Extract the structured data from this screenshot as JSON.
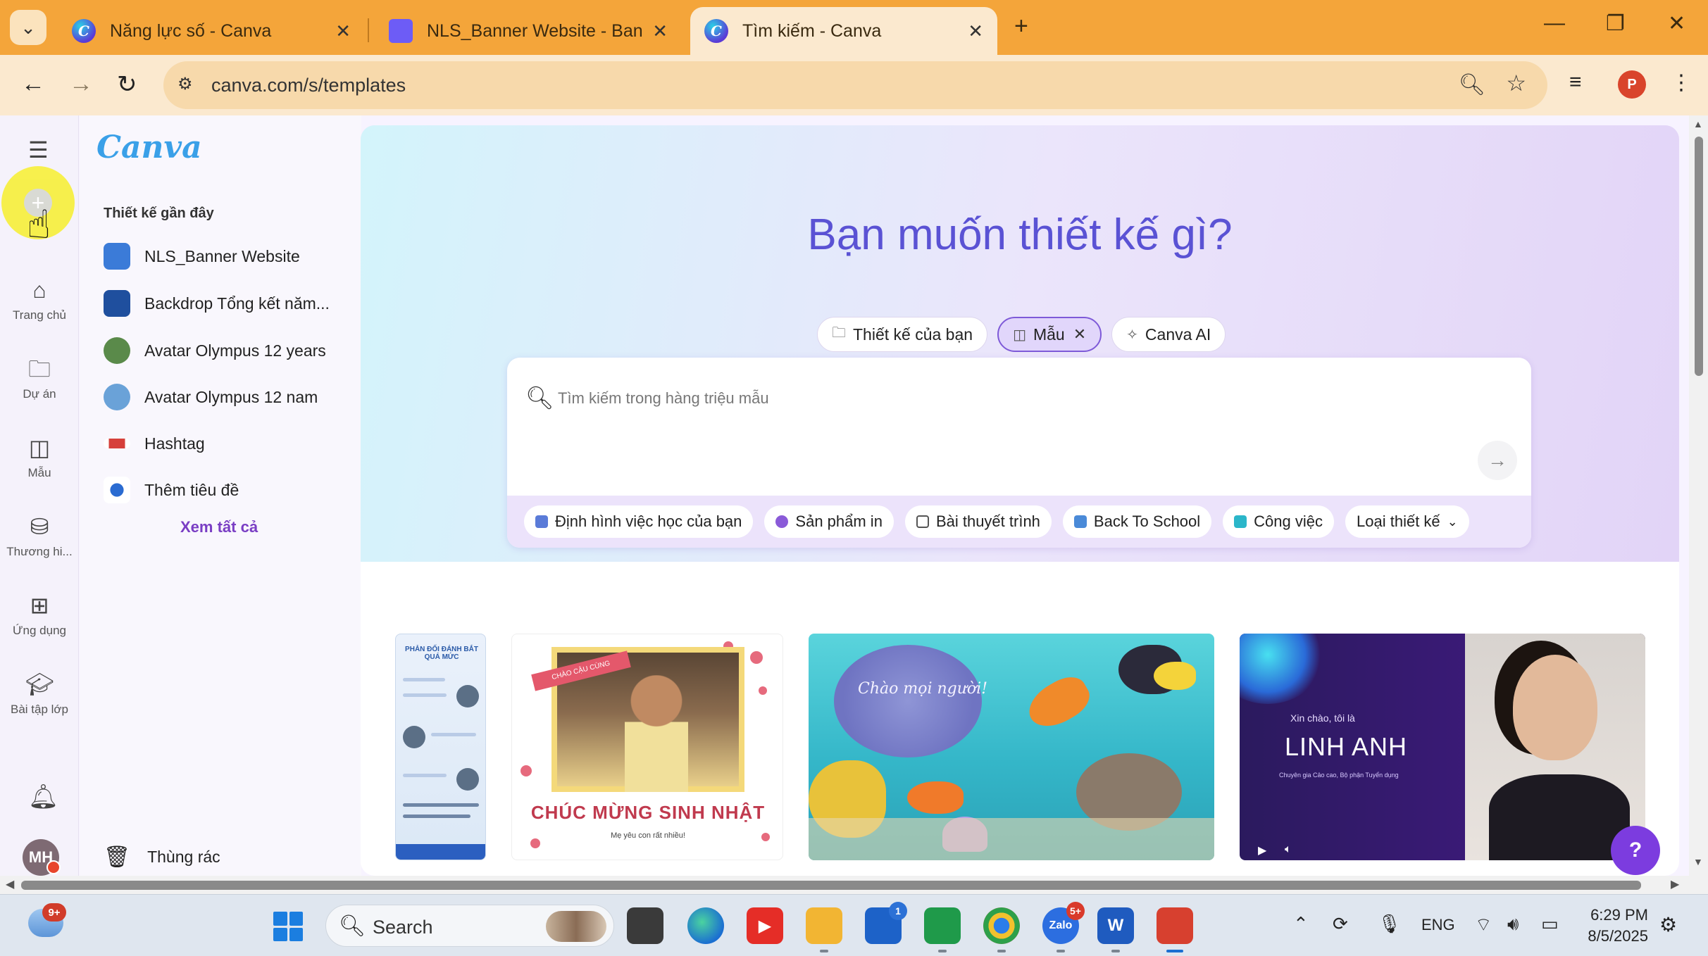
{
  "browser": {
    "tabs": [
      {
        "label": "Năng lực số - Canva",
        "active": false
      },
      {
        "label": "NLS_Banner Website - Banner r",
        "active": false
      },
      {
        "label": "Tìm kiếm - Canva",
        "active": true
      }
    ],
    "url": "canva.com/s/templates",
    "colors": {
      "tabstrip": "#f4a53a",
      "toolbar": "#fbe9cf"
    }
  },
  "rail": {
    "items": [
      {
        "label": "Trang chủ",
        "icon": "home-icon"
      },
      {
        "label": "Dự án",
        "icon": "folder-icon"
      },
      {
        "label": "Mẫu",
        "icon": "template-icon"
      },
      {
        "label": "Thương hi...",
        "icon": "brand-icon"
      },
      {
        "label": "Ứng dụng",
        "icon": "apps-icon"
      },
      {
        "label": "Bài tập lớp",
        "icon": "graduation-cap-icon"
      }
    ],
    "avatar_initials": "MH"
  },
  "panel": {
    "logo": "Canva",
    "recent_title": "Thiết kế gần đây",
    "recent_items": [
      {
        "label": "NLS_Banner Website",
        "color": "#3b7bd8"
      },
      {
        "label": "Backdrop Tổng kết năm...",
        "color": "#1f4f9e"
      },
      {
        "label": "Avatar Olympus 12 years",
        "color": "#5a8a4a"
      },
      {
        "label": "Avatar Olympus 12 nam",
        "color": "#6aa2d8"
      },
      {
        "label": "Hashtag",
        "color": "#d6403a"
      },
      {
        "label": "Thêm tiêu đề",
        "color": "#2a6bd1"
      }
    ],
    "see_all": "Xem tất cả",
    "trash": "Thùng rác"
  },
  "hero": {
    "title": "Bạn muốn thiết kế gì?",
    "pills": [
      {
        "label": "Thiết kế của bạn",
        "icon": "folder-icon",
        "selected": false
      },
      {
        "label": "Mẫu",
        "icon": "template-icon",
        "selected": true
      },
      {
        "label": "Canva AI",
        "icon": "sparkle-icon",
        "selected": false
      }
    ],
    "search_placeholder": "Tìm kiếm trong hàng triệu mẫu",
    "chips": [
      {
        "label": "Định hình việc học của bạn",
        "color": "#5a7bd8"
      },
      {
        "label": "Sản phẩm in",
        "color": "#8a5ad8"
      },
      {
        "label": "Bài thuyết trình",
        "color": "#555555"
      },
      {
        "label": "Back To School",
        "color": "#4a8ad8"
      },
      {
        "label": "Công việc",
        "color": "#2bb6c9"
      },
      {
        "label": "Loại thiết kế",
        "color": ""
      }
    ],
    "accent": "#5a52d4"
  },
  "templates": {
    "card1": {
      "title": "PHẢN ĐỐI ĐÁNH BẮT QUÁ MỨC"
    },
    "card2": {
      "ribbon": "CHÀO CẬU CÙNG",
      "title": "CHÚC MỪNG SINH NHẬT",
      "sub": "Mẹ yêu con rất nhiều!"
    },
    "card3": {
      "text": "Chào mọi người!"
    },
    "card4": {
      "hello": "Xin chào, tôi là",
      "name": "LINH ANH",
      "sub": "Chuyên gia Cảo cao, Bộ phận Tuyển dụng"
    }
  },
  "taskbar": {
    "weather_badge": "9+",
    "search_label": "Search",
    "store_badge": "1",
    "zalo_badge": "5+",
    "lang": "ENG",
    "time": "6:29 PM",
    "date": "8/5/2025"
  }
}
